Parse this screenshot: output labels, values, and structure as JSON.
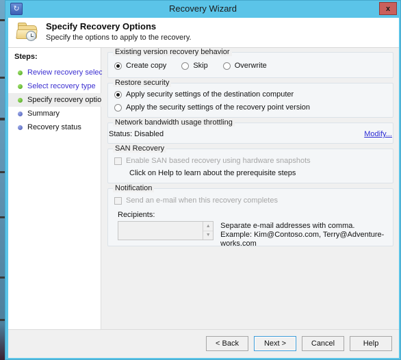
{
  "window": {
    "title": "Recovery Wizard",
    "icon": "recovery-clock-icon",
    "close_label": "x"
  },
  "header": {
    "icon": "folder-clock-icon",
    "title": "Specify Recovery Options",
    "subtitle": "Specify the options to apply to the recovery."
  },
  "sidebar": {
    "title": "Steps:",
    "items": [
      {
        "label": "Review recovery selection",
        "state": "done"
      },
      {
        "label": "Select recovery type",
        "state": "done"
      },
      {
        "label": "Specify recovery options",
        "state": "current"
      },
      {
        "label": "Summary",
        "state": "todo"
      },
      {
        "label": "Recovery status",
        "state": "todo"
      }
    ]
  },
  "main": {
    "existing_version": {
      "legend": "Existing version recovery behavior",
      "options": [
        {
          "label": "Create copy",
          "checked": true
        },
        {
          "label": "Skip",
          "checked": false
        },
        {
          "label": "Overwrite",
          "checked": false
        }
      ]
    },
    "restore_security": {
      "legend": "Restore security",
      "options": [
        {
          "label": "Apply security settings of the destination computer",
          "checked": true
        },
        {
          "label": "Apply the security settings of the recovery point version",
          "checked": false
        }
      ]
    },
    "throttling": {
      "legend": "Network bandwidth usage throttling",
      "status": "Status: Disabled",
      "modify_link": "Modify..."
    },
    "san_recovery": {
      "legend": "SAN Recovery",
      "checkbox_label": "Enable SAN based recovery using hardware snapshots",
      "note": "Click on Help to learn about the prerequisite steps"
    },
    "notification": {
      "legend": "Notification",
      "checkbox_label": "Send an e-mail when this recovery completes",
      "recipients_label": "Recipients:",
      "recipients_value": "",
      "hint_line1": "Separate e-mail addresses with comma.",
      "hint_line2": "Example: Kim@Contoso.com, Terry@Adventure-works.com"
    }
  },
  "footer": {
    "buttons": [
      {
        "label": "< Back",
        "default": false
      },
      {
        "label": "Next >",
        "default": true
      },
      {
        "label": "Cancel",
        "default": false
      },
      {
        "label": "Help",
        "default": false
      }
    ]
  },
  "colors": {
    "accent": "#5bc4e8",
    "link": "#2b2bd4",
    "step_link": "#3b2fd1",
    "close": "#c9605c"
  }
}
